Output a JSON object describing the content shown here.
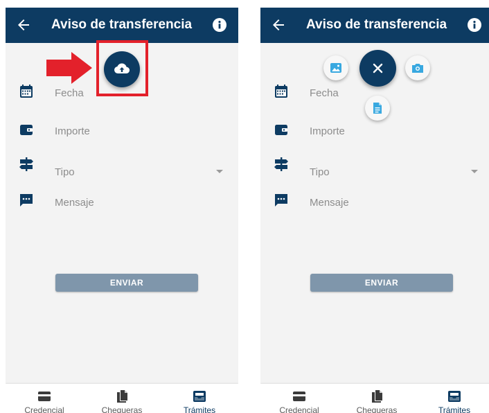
{
  "screens": [
    {
      "appbar": {
        "title": "Aviso de transferencia"
      },
      "fields": [
        {
          "label": "Fecha",
          "icon": "calendar-icon"
        },
        {
          "label": "Importe",
          "icon": "wallet-icon"
        },
        {
          "label": "Tipo",
          "icon": "signpost-icon"
        },
        {
          "label": "Mensaje",
          "icon": "message-icon"
        }
      ],
      "send_label": "ENVIAR",
      "nav": [
        {
          "label": "Credencial",
          "icon": "card-icon"
        },
        {
          "label": "Chequeras",
          "icon": "documents-icon"
        },
        {
          "label": "Trámites",
          "icon": "inbox-icon",
          "active": true
        }
      ]
    },
    {
      "appbar": {
        "title": "Aviso de transferencia"
      },
      "fields": [
        {
          "label": "Fecha",
          "icon": "calendar-icon"
        },
        {
          "label": "Importe",
          "icon": "wallet-icon"
        },
        {
          "label": "Tipo",
          "icon": "signpost-icon"
        },
        {
          "label": "Mensaje",
          "icon": "message-icon"
        }
      ],
      "send_label": "ENVIAR",
      "nav": [
        {
          "label": "Credencial",
          "icon": "card-icon"
        },
        {
          "label": "Chequeras",
          "icon": "documents-icon"
        },
        {
          "label": "Trámites",
          "icon": "inbox-icon",
          "active": true
        }
      ]
    }
  ],
  "colors": {
    "primary": "#0d3b62",
    "background": "#f3f3f3",
    "button_disabled": "#7f96ab",
    "highlight_red": "#e3212b",
    "icon_light_blue": "#38a8e0"
  }
}
